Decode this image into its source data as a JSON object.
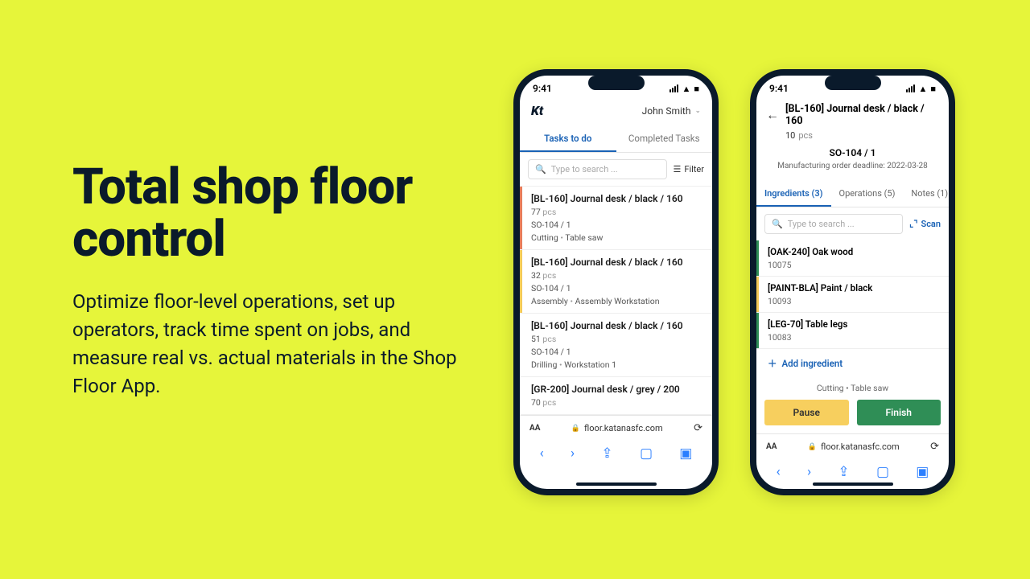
{
  "hero": {
    "title": "Total shop floor control",
    "body": "Optimize floor-level operations, set up operators, track time spent on jobs, and measure real vs. actual materials in the Shop Floor App."
  },
  "phone_common": {
    "time": "9:41",
    "url": "floor.katanasfc.com",
    "aa": "AA"
  },
  "left": {
    "logo": "Kt",
    "user": "John Smith",
    "tabs": {
      "active": "Tasks to do",
      "other": "Completed Tasks"
    },
    "search_placeholder": "Type to search ...",
    "filter": "Filter",
    "tasks": [
      {
        "title": "[BL-160] Journal desk / black / 160",
        "qty": "77",
        "unit": "pcs",
        "so": "SO-104 / 1",
        "op": "Cutting",
        "station": "Table saw",
        "color": "#e57b5a"
      },
      {
        "title": "[BL-160] Journal desk / black / 160",
        "qty": "32",
        "unit": "pcs",
        "so": "SO-104 / 1",
        "op": "Assembly",
        "station": "Assembly Workstation",
        "color": "#f3c958"
      },
      {
        "title": "[BL-160] Journal desk / black / 160",
        "qty": "51",
        "unit": "pcs",
        "so": "SO-104 / 1",
        "op": "Drilling",
        "station": "Workstation 1",
        "color": "#ffffff"
      },
      {
        "title": "[GR-200] Journal desk / grey / 200",
        "qty": "70",
        "unit": "pcs",
        "so": "",
        "op": "",
        "station": "",
        "color": "#ffffff"
      }
    ]
  },
  "right": {
    "title": "[BL-160] Journal desk / black / 160",
    "qty": "10",
    "unit": "pcs",
    "so": "SO-104 / 1",
    "deadline": "Manufacturing order deadline: 2022-03-28",
    "tabs": {
      "a": "Ingredients (3)",
      "b": "Operations (5)",
      "c": "Notes (1)"
    },
    "search_placeholder": "Type to search ...",
    "scan": "Scan",
    "ings": [
      {
        "name": "[OAK-240] Oak wood",
        "code": "10075",
        "color": "#2f8e56"
      },
      {
        "name": "[PAINT-BLA] Paint / black",
        "code": "10093",
        "color": "#f3c958"
      },
      {
        "name": "[LEG-70] Table legs",
        "code": "10083",
        "color": "#2f8e56"
      }
    ],
    "add": "Add ingredient",
    "opstatus": {
      "op": "Cutting",
      "station": "Table saw"
    },
    "buttons": {
      "pause": "Pause",
      "finish": "Finish"
    }
  }
}
